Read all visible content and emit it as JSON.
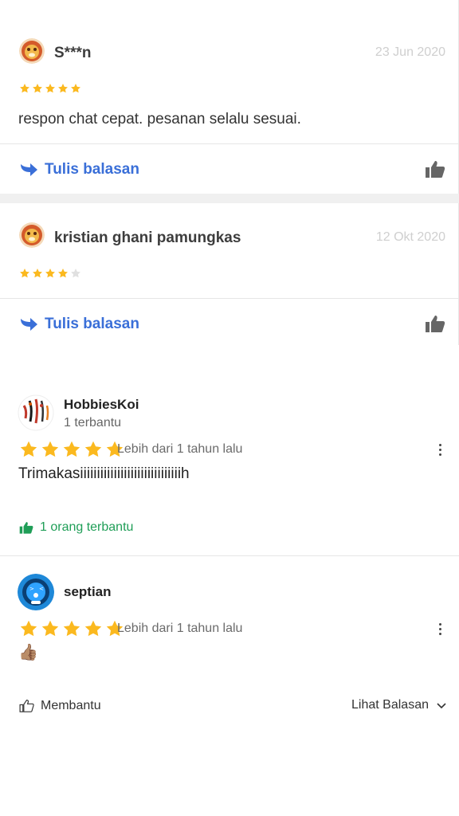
{
  "reviews_top": [
    {
      "username": "S***n",
      "date": "23 Jun 2020",
      "rating": 5,
      "text": "respon chat cepat. pesanan selalu sesuai.",
      "reply_label": "Tulis balasan"
    },
    {
      "username": "kristian ghani pamungkas",
      "date": "12 Okt 2020",
      "rating": 4,
      "text": "",
      "reply_label": "Tulis balasan"
    }
  ],
  "reviews_bottom": [
    {
      "username": "HobbiesKoi",
      "subtitle": "1 terbantu",
      "rating": 5,
      "time": "Lebih dari 1 tahun lalu",
      "text": "Trimakasiiiiiiiiiiiiiiiiiiiiiiiiiiiiiih",
      "helpful": "1 orang terbantu"
    },
    {
      "username": "septian",
      "rating": 5,
      "time": "Lebih dari 1 tahun lalu",
      "text": "👍🏽",
      "helpful_button": "Membantu",
      "view_replies": "Lihat Balasan"
    }
  ],
  "colors": {
    "star": "#fbb91f",
    "star_empty": "#e0e0e0",
    "link_blue": "#3a6fd8",
    "green": "#1f9e57",
    "date_gray": "#cfcfcf"
  },
  "icons": [
    "reply-arrow-icon",
    "thumbs-up-icon",
    "star-icon",
    "more-vertical-icon",
    "chevron-down-icon"
  ]
}
